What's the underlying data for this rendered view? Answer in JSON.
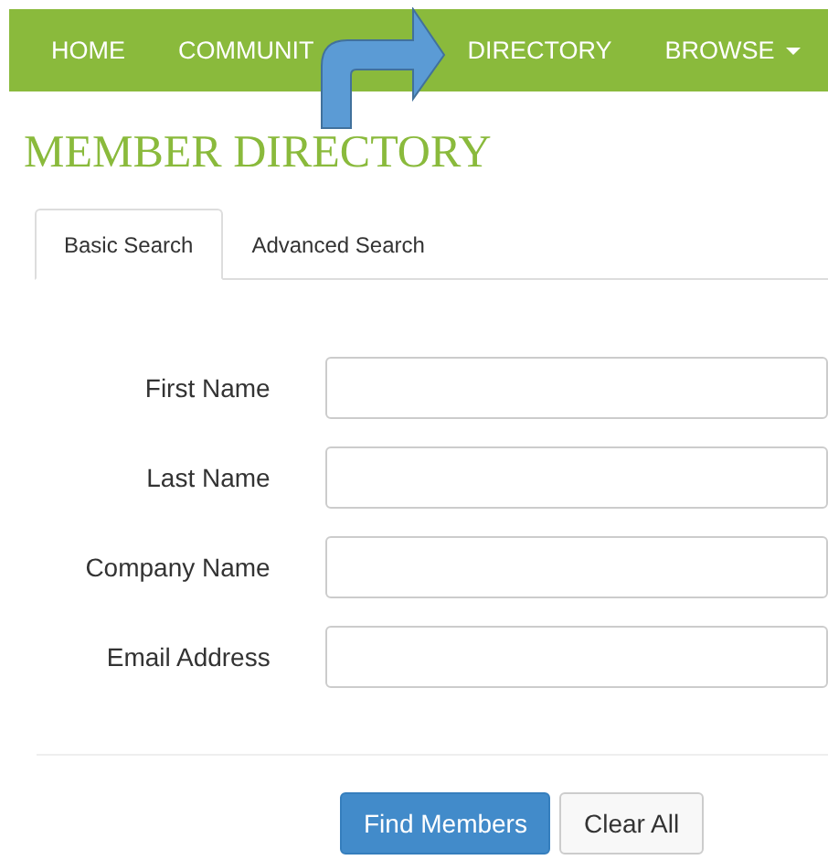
{
  "nav": {
    "items": [
      {
        "label": "HOME",
        "dropdown": false
      },
      {
        "label": "COMMUNIT",
        "dropdown": false
      },
      {
        "label": "DIRECTORY",
        "dropdown": false
      },
      {
        "label": "BROWSE",
        "dropdown": true
      }
    ]
  },
  "heading": "MEMBER DIRECTORY",
  "tabs": [
    {
      "label": "Basic Search",
      "selected": true
    },
    {
      "label": "Advanced Search",
      "selected": false
    }
  ],
  "form": {
    "fields": [
      {
        "label": "First Name"
      },
      {
        "label": "Last Name"
      },
      {
        "label": "Company Name"
      },
      {
        "label": "Email Address"
      }
    ]
  },
  "buttons": [
    {
      "label": "Find Members",
      "kind": "primary"
    },
    {
      "label": "Clear All",
      "kind": "default"
    }
  ]
}
